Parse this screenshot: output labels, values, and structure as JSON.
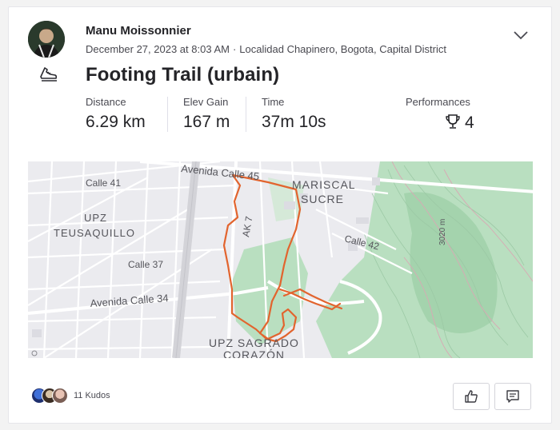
{
  "activity": {
    "athlete_name": "Manu Moissonnier",
    "date": "December 27, 2023 at 8:03 AM",
    "separator": "·",
    "location": "Localidad Chapinero, Bogota, Capital District",
    "title": "Footing Trail (urbain)",
    "sport_icon": "run-shoe-icon"
  },
  "stats": [
    {
      "label": "Distance",
      "value": "6.29 km"
    },
    {
      "label": "Elev Gain",
      "value": "167 m"
    },
    {
      "label": "Time",
      "value": "37m 10s"
    }
  ],
  "performances": {
    "label": "Performances",
    "value": "4",
    "icon": "trophy-icon"
  },
  "map": {
    "labels": {
      "avenida_calle_45": "Avenida Calle 45",
      "calle_41": "Calle 41",
      "upz_teusaquillo_1": "UPZ",
      "upz_teusaquillo_2": "TEUSAQUILLO",
      "calle_37": "Calle 37",
      "avenida_calle_34": "Avenida Calle 34",
      "ak7": "AK 7",
      "mariscal": "MARISCAL",
      "sucre": "SUCRE",
      "calle_42": "Calle 42",
      "elev_3020": "3020 m",
      "upz_sagrado": "UPZ SAGRADO",
      "corazon": "CORAZÓN"
    },
    "route_color": "#e2642e",
    "park_color": "#b9dfc0"
  },
  "kudos": {
    "text": "11 Kudos"
  },
  "actions": {
    "like_icon": "thumbs-up-icon",
    "comment_icon": "comment-icon"
  }
}
